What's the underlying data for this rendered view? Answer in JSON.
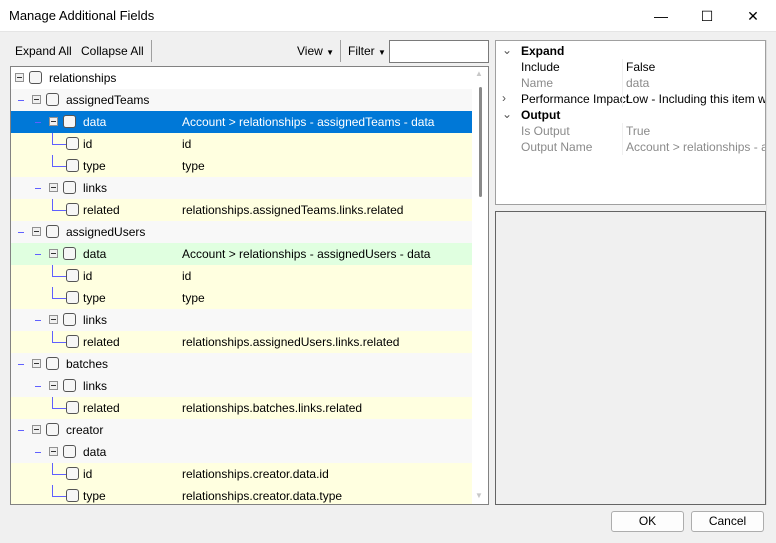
{
  "window": {
    "title": "Manage Additional Fields",
    "minimize_icon": "minimize-icon",
    "maximize_icon": "maximize-icon",
    "close_icon": "close-icon"
  },
  "toolbar": {
    "expand_all": "Expand All",
    "collapse_all": "Collapse All",
    "view": "View",
    "filter": "Filter",
    "filter_value": ""
  },
  "colors": {
    "selected": "#0078d7",
    "leaf": "#ffffe0",
    "included": "#e0ffe0",
    "container": "#f8f8f8"
  },
  "tree": [
    {
      "level": 0,
      "label": "relationships",
      "value": "",
      "kind": "root"
    },
    {
      "level": 1,
      "label": "assignedTeams",
      "value": "",
      "kind": "container"
    },
    {
      "level": 2,
      "label": "data",
      "value": "Account > relationships - assignedTeams - data",
      "kind": "selected"
    },
    {
      "level": 3,
      "label": "id",
      "value": "id",
      "kind": "leaf"
    },
    {
      "level": 3,
      "label": "type",
      "value": "type",
      "kind": "leaf"
    },
    {
      "level": 2,
      "label": "links",
      "value": "",
      "kind": "container"
    },
    {
      "level": 3,
      "label": "related",
      "value": "relationships.assignedTeams.links.related",
      "kind": "leaf"
    },
    {
      "level": 1,
      "label": "assignedUsers",
      "value": "",
      "kind": "container"
    },
    {
      "level": 2,
      "label": "data",
      "value": "Account > relationships - assignedUsers - data",
      "kind": "included"
    },
    {
      "level": 3,
      "label": "id",
      "value": "id",
      "kind": "leaf"
    },
    {
      "level": 3,
      "label": "type",
      "value": "type",
      "kind": "leaf"
    },
    {
      "level": 2,
      "label": "links",
      "value": "",
      "kind": "container"
    },
    {
      "level": 3,
      "label": "related",
      "value": "relationships.assignedUsers.links.related",
      "kind": "leaf"
    },
    {
      "level": 1,
      "label": "batches",
      "value": "",
      "kind": "container"
    },
    {
      "level": 2,
      "label": "links",
      "value": "",
      "kind": "container"
    },
    {
      "level": 3,
      "label": "related",
      "value": "relationships.batches.links.related",
      "kind": "leaf"
    },
    {
      "level": 1,
      "label": "creator",
      "value": "",
      "kind": "container"
    },
    {
      "level": 2,
      "label": "data",
      "value": "",
      "kind": "container"
    },
    {
      "level": 3,
      "label": "id",
      "value": "relationships.creator.data.id",
      "kind": "leaf"
    },
    {
      "level": 3,
      "label": "type",
      "value": "relationships.creator.data.type",
      "kind": "leaf"
    }
  ],
  "properties": [
    {
      "type": "category",
      "key": "Expand",
      "expanded": true
    },
    {
      "type": "prop",
      "key": "Include",
      "value": "False",
      "readonly": false
    },
    {
      "type": "prop",
      "key": "Name",
      "value": "data",
      "readonly": true
    },
    {
      "type": "prop",
      "key": "Performance Impact",
      "value": "Low - Including this item will h",
      "readonly": false,
      "expandable": true
    },
    {
      "type": "category",
      "key": "Output",
      "expanded": true
    },
    {
      "type": "prop",
      "key": "Is Output",
      "value": "True",
      "readonly": true
    },
    {
      "type": "prop",
      "key": "Output Name",
      "value": "Account > relationships - assig",
      "readonly": true
    }
  ],
  "buttons": {
    "ok": "OK",
    "cancel": "Cancel"
  }
}
